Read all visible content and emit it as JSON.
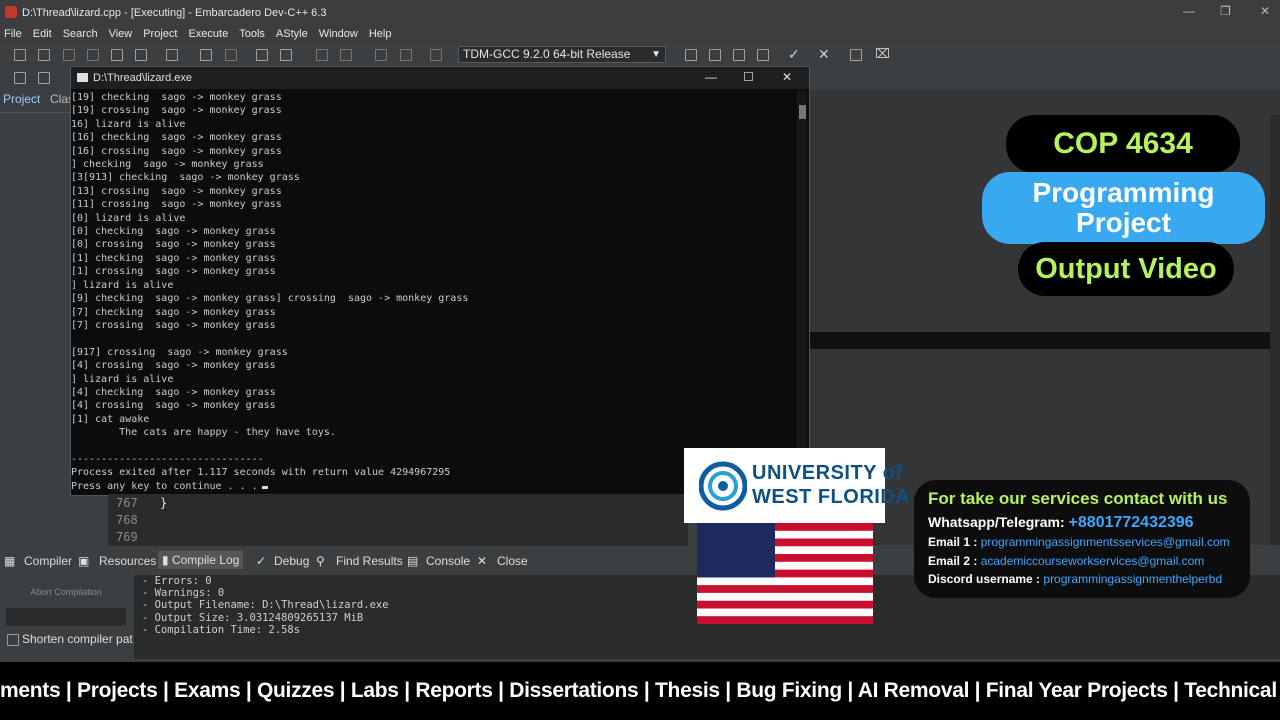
{
  "window": {
    "title": "D:\\Thread\\lizard.cpp - [Executing] - Embarcadero Dev-C++ 6.3",
    "menu": [
      "File",
      "Edit",
      "Search",
      "View",
      "Project",
      "Execute",
      "Tools",
      "AStyle",
      "Window",
      "Help"
    ],
    "compiler_select": "TDM-GCC 9.2.0 64-bit Release"
  },
  "left_panel": {
    "tab_project": "Project",
    "tab_classes": "Clas"
  },
  "console": {
    "title": "D:\\Thread\\lizard.exe",
    "lines": [
      "[19] checking  sago -> monkey grass",
      "[19] crossing  sago -> monkey grass",
      "16] lizard is alive",
      "[16] checking  sago -> monkey grass",
      "[16] crossing  sago -> monkey grass",
      "] checking  sago -> monkey grass",
      "[3[913] checking  sago -> monkey grass",
      "[13] crossing  sago -> monkey grass",
      "[11] crossing  sago -> monkey grass",
      "[0] lizard is alive",
      "[0] checking  sago -> monkey grass",
      "[0] crossing  sago -> monkey grass",
      "[1] checking  sago -> monkey grass",
      "[1] crossing  sago -> monkey grass",
      "] lizard is alive",
      "[9] checking  sago -> monkey grass] crossing  sago -> monkey grass",
      "[7] checking  sago -> monkey grass",
      "[7] crossing  sago -> monkey grass",
      "",
      "[917] crossing  sago -> monkey grass",
      "[4] crossing  sago -> monkey grass",
      "] lizard is alive",
      "[4] checking  sago -> monkey grass",
      "[4] crossing  sago -> monkey grass",
      "[1] cat awake",
      "        The cats are happy - they have toys.",
      "",
      "--------------------------------",
      "Process exited after 1.117 seconds with return value 4294967295",
      "Press any key to continue . . ."
    ]
  },
  "editor": {
    "lines": [
      {
        "num": "767",
        "code": "}"
      },
      {
        "num": "768",
        "code": ""
      },
      {
        "num": "769",
        "code": ""
      }
    ]
  },
  "bottom_tabs": [
    "Compiler",
    "Resources",
    "Compile Log",
    "Debug",
    "Find Results",
    "Console",
    "Close"
  ],
  "compile_log": {
    "abort_label": "Abort Compilation",
    "shorten_label": "Shorten compiler pat",
    "lines": [
      "- Errors: 0",
      "- Warnings: 0",
      "- Output Filename: D:\\Thread\\lizard.exe",
      "- Output Size: 3.03124809265137 MiB",
      "- Compilation Time: 2.58s"
    ]
  },
  "promo": {
    "course": "COP 4634",
    "project_line1": "Programming",
    "project_line2": "Project",
    "output": "Output Video",
    "uni_line1": "UNIVERSITY of",
    "uni_line2": "WEST FLORIDA",
    "contact_heading": "For take our services contact with us",
    "whatsapp_label": "Whatsapp/Telegram:",
    "whatsapp_value": "+8801772432396",
    "email1_label": "Email 1 :",
    "email1_value": "programmingassignmentsservices@gmail.com",
    "email2_label": "Email 2 :",
    "email2_value": "academiccourseworkservices@gmail.com",
    "discord_label": "Discord username :",
    "discord_value": "programmingassignmenthelperbd",
    "ticker": "ments | Projects | Exams | Quizzes | Labs | Reports | Dissertations | Thesis | Bug Fixing | AI Removal | Final Year Projects | Technical W"
  },
  "colors": {
    "accent_green": "#b6f25a",
    "accent_blue": "#38a8f0",
    "link_blue": "#3aa8ff"
  }
}
